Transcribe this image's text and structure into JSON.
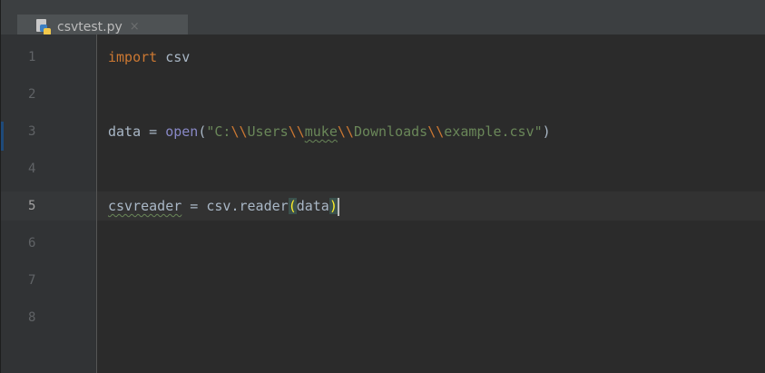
{
  "tab": {
    "filename": "csvtest.py",
    "close_glyph": "×",
    "icon": "python-file-icon"
  },
  "gutter": {
    "lines": [
      "1",
      "2",
      "3",
      "4",
      "5",
      "6",
      "7",
      "8"
    ],
    "current_line": "5"
  },
  "code": {
    "line1": {
      "keyword": "import",
      "rest": " csv"
    },
    "line3": {
      "lhs": "data = ",
      "func": "open",
      "open_paren": "(",
      "str_q1": "\"C:",
      "esc1": "\\\\",
      "str_users": "Users",
      "esc2": "\\\\",
      "str_muke": "muke",
      "esc3": "\\\\",
      "str_downloads": "Downloads",
      "esc4": "\\\\",
      "str_file": "example.csv\"",
      "close_paren": ")"
    },
    "line5": {
      "var": "csvreader",
      "mid": " = csv.reader",
      "open_paren": "(",
      "arg": "data",
      "close_paren": ")"
    }
  },
  "colors": {
    "background": "#2b2b2b",
    "gutter": "#313335",
    "keyword": "#cc7832",
    "string": "#6a8759",
    "builtin": "#8888c6",
    "text": "#a9b7c6",
    "tab_underline": "#4a88c7"
  }
}
